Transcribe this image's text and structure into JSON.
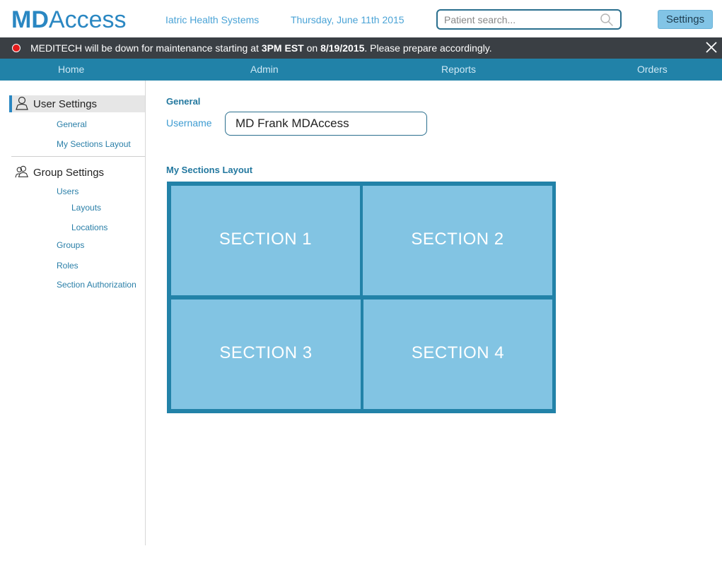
{
  "header": {
    "logo_bold": "MD",
    "logo_rest": "Access",
    "org_name": "Iatric Health Systems",
    "date": "Thursday, June 11th 2015",
    "search_placeholder": "Patient search...",
    "settings_label": "Settings"
  },
  "alert": {
    "pre": "MEDITECH will be down for maintenance starting at ",
    "time": "3PM EST",
    "mid": " on ",
    "date": "8/19/2015",
    "post": ". Please prepare accordingly."
  },
  "nav": {
    "tabs": [
      {
        "label": "Home"
      },
      {
        "label": "Admin"
      },
      {
        "label": "Reports"
      },
      {
        "label": "Orders"
      }
    ]
  },
  "sidebar": {
    "user_settings": {
      "label": "User Settings",
      "items": [
        "General",
        "My Sections Layout"
      ]
    },
    "group_settings": {
      "label": "Group Settings",
      "users": "Users",
      "user_sub": [
        "Layouts",
        "Locations"
      ],
      "items": [
        "Groups",
        "Roles",
        "Section Authorization"
      ]
    }
  },
  "main": {
    "general_title": "General",
    "username_label": "Username",
    "username_value": "MD Frank MDAccess",
    "layout_title": "My Sections Layout",
    "sections": [
      "SECTION 1",
      "SECTION 2",
      "SECTION 3",
      "SECTION 4"
    ]
  },
  "colors": {
    "brand": "#2a87c2",
    "nav_bg": "#2182a8",
    "alert_bg": "#3a3f44",
    "alert_dot": "#e41b1b",
    "section_fill": "#82c4e3"
  }
}
